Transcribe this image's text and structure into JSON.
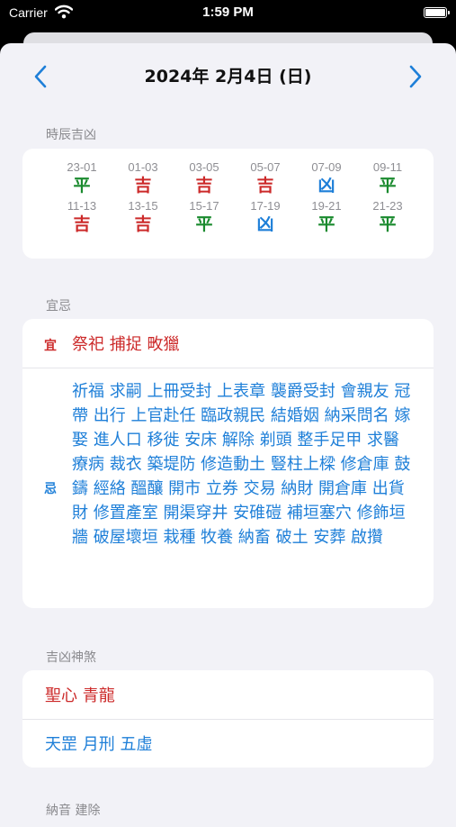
{
  "status_bar": {
    "carrier": "Carrier",
    "time": "1:59 PM"
  },
  "header": {
    "date": "2024年 2月4日 (日)"
  },
  "hours_section": {
    "label": "時辰吉凶",
    "items": [
      {
        "range": "23-01",
        "value": "平",
        "color": "#1a8a2e"
      },
      {
        "range": "01-03",
        "value": "吉",
        "color": "#cc2a2a"
      },
      {
        "range": "03-05",
        "value": "吉",
        "color": "#cc2a2a"
      },
      {
        "range": "05-07",
        "value": "吉",
        "color": "#cc2a2a"
      },
      {
        "range": "07-09",
        "value": "凶",
        "color": "#1e7fd8"
      },
      {
        "range": "09-11",
        "value": "平",
        "color": "#1a8a2e"
      },
      {
        "range": "11-13",
        "value": "吉",
        "color": "#cc2a2a"
      },
      {
        "range": "13-15",
        "value": "吉",
        "color": "#cc2a2a"
      },
      {
        "range": "15-17",
        "value": "平",
        "color": "#1a8a2e"
      },
      {
        "range": "17-19",
        "value": "凶",
        "color": "#1e7fd8"
      },
      {
        "range": "19-21",
        "value": "平",
        "color": "#1a8a2e"
      },
      {
        "range": "21-23",
        "value": "平",
        "color": "#1a8a2e"
      }
    ]
  },
  "yiji_section": {
    "label": "宜忌",
    "yi_tag": "宜",
    "yi_text": "祭祀 捕捉 畋獵",
    "ji_tag": "忌",
    "ji_text": "祈福 求嗣 上冊受封 上表章 襲爵受封 會親友 冠帶 出行 上官赴任 臨政親民 結婚姻 納采問名 嫁娶 進人口 移徙 安床 解除 剃頭 整手足甲 求醫療病 裁衣 築堤防 修造動土 豎柱上樑 修倉庫 鼓鑄 經絡 醞釀 開市 立券 交易 納財 開倉庫 出貨財 修置產室 開渠穿井 安碓磑 補垣塞穴 修飾垣牆 破屋壞垣 栽種 牧養 納畜 破土 安葬 啟攢"
  },
  "shensha_section": {
    "label": "吉凶神煞",
    "good": "聖心 青龍",
    "bad": "天罡 月刑 五虛"
  },
  "next_section": {
    "label": "納音 建除"
  },
  "colors": {
    "auspicious": "#cc2a2a",
    "inauspicious": "#1e7fd8",
    "neutral": "#1a8a2e",
    "accent": "#1e7fd8"
  }
}
